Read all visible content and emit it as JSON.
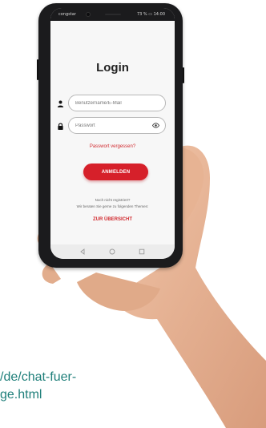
{
  "status_bar": {
    "carrier": "congstar",
    "right_text": "⠀⠀73 % ▭ 14:00"
  },
  "login": {
    "title": "Login",
    "username_placeholder": "Benutzername/E-Mail",
    "password_placeholder": "Passwort",
    "forgot_password": "Passwort vergessen?",
    "submit_label": "ANMELDEN",
    "not_registered": "Noch nicht registriert?",
    "topics_text": "Wir beraten Sie gerne zu folgenden Themen:",
    "overview_link": "ZUR ÜBERSICHT"
  },
  "caption": {
    "line1": "/de/chat-fuer-",
    "line2": "ge.html"
  },
  "colors": {
    "accent": "#d6202a",
    "link": "#d12a2f",
    "caption": "#1f7f7a"
  }
}
